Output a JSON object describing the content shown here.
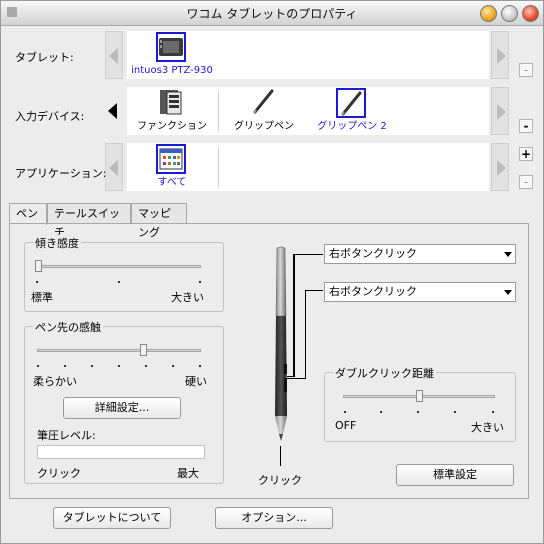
{
  "window": {
    "title": "ワコム タブレットのプロパティ"
  },
  "rows": {
    "tablet": {
      "label": "タブレット:",
      "items": [
        {
          "caption": "intuos3 PTZ-930",
          "icon": "tablet-icon",
          "selected": true
        }
      ]
    },
    "input_device": {
      "label": "入力デバイス:",
      "items": [
        {
          "caption": "ファンクション",
          "icon": "function-keys-icon",
          "selected": false
        },
        {
          "caption": "グリップペン",
          "icon": "pen-icon",
          "selected": false
        },
        {
          "caption": "グリップペン 2",
          "icon": "pen-icon",
          "selected": true
        }
      ]
    },
    "application": {
      "label": "アプリケーション:",
      "items": [
        {
          "caption": "すべて",
          "icon": "all-apps-icon",
          "selected": true
        }
      ]
    }
  },
  "side_buttons": {
    "minus": "-",
    "plus": "+"
  },
  "tabs": [
    {
      "label": "ペン",
      "active": true
    },
    {
      "label": "テールスイッチ",
      "active": false
    },
    {
      "label": "マッピング",
      "active": false
    }
  ],
  "tilt": {
    "title": "傾き感度",
    "min_label": "標準",
    "max_label": "大きい",
    "level_fraction": 0.0
  },
  "tip_feel": {
    "title": "ペン先の感触",
    "min_label": "柔らかい",
    "max_label": "硬い",
    "level_fraction": 0.62,
    "details_button": "詳細設定..."
  },
  "pressure": {
    "label": "筆圧レベル:",
    "min_label": "クリック",
    "max_label": "最大"
  },
  "pen_buttons": {
    "upper": "右ボタンクリック",
    "lower": "右ボタンクリック",
    "tip_label": "クリック"
  },
  "double_click": {
    "title": "ダブルクリック距離",
    "min_label": "OFF",
    "max_label": "大きい",
    "level_fraction": 0.5
  },
  "buttons": {
    "defaults": "標準設定",
    "about": "タブレットについて",
    "options": "オプション..."
  },
  "colors": {
    "selection": "#1a1ad4",
    "window_bg": "#ececec"
  }
}
